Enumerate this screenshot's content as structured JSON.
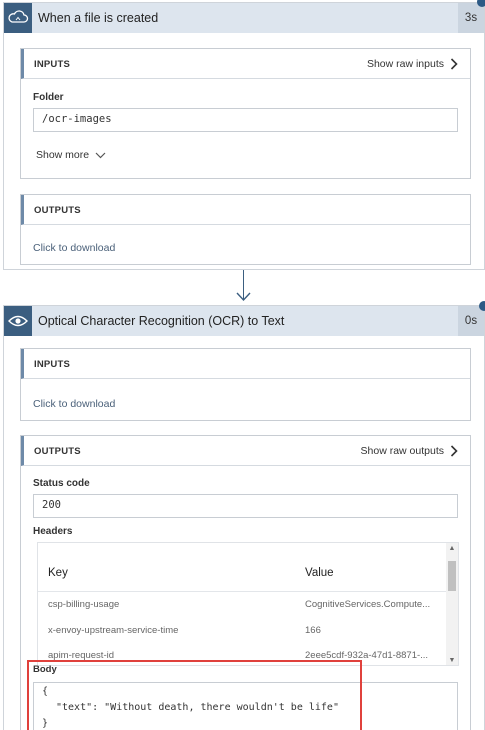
{
  "trigger": {
    "title": "When a file is created",
    "duration": "3s",
    "inputs": {
      "title": "INPUTS",
      "raw_link": "Show raw inputs",
      "folder_label": "Folder",
      "folder_value": "/ocr-images",
      "show_more": "Show more"
    },
    "outputs": {
      "title": "OUTPUTS",
      "download": "Click to download"
    }
  },
  "action": {
    "title": "Optical Character Recognition (OCR) to Text",
    "duration": "0s",
    "inputs": {
      "title": "INPUTS",
      "download": "Click to download"
    },
    "outputs": {
      "title": "OUTPUTS",
      "raw_link": "Show raw outputs",
      "status_label": "Status code",
      "status_value": "200",
      "headers_label": "Headers",
      "headers_columns": [
        "Key",
        "Value"
      ],
      "headers_rows": [
        {
          "key": "csp-billing-usage",
          "value": "CognitiveServices.Compute..."
        },
        {
          "key": "x-envoy-upstream-service-time",
          "value": "166"
        },
        {
          "key": "apim-request-id",
          "value": "2eee5cdf-932a-47d1-8871-..."
        }
      ],
      "body_label": "Body",
      "body_lines": [
        "{",
        "\"text\": \"Without death, there wouldn't be life\"",
        "}"
      ]
    }
  },
  "colors": {
    "header_bg": "#dde5ee",
    "icon_bg": "#3b5e80",
    "highlight": "#e0413c"
  },
  "icons": {
    "trigger_icon": "cloud-icon",
    "action_icon": "eye-icon"
  }
}
